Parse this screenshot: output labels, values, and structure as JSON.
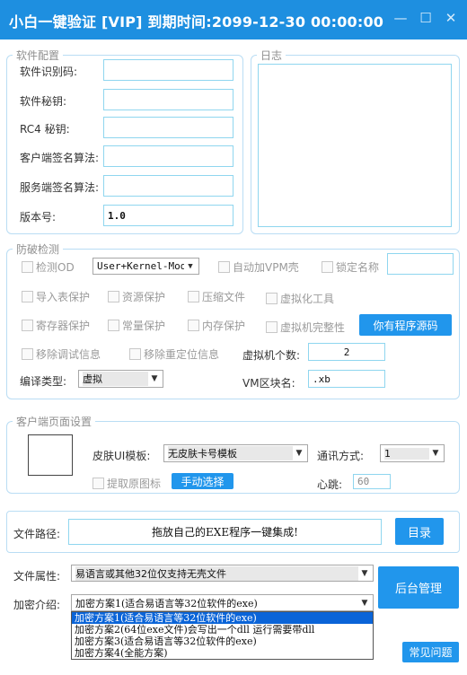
{
  "window": {
    "title": "小白一键验证 [VIP]  到期时间:2099-12-30 00:00:00",
    "minimize": "—",
    "maximize": "☐",
    "close": "✕"
  },
  "config": {
    "legend": "软件配置",
    "fields": [
      {
        "label": "软件识别码:",
        "value": ""
      },
      {
        "label": "软件秘钥:",
        "value": ""
      },
      {
        "label": "RC4 秘钥:",
        "value": ""
      },
      {
        "label": "客户端签名算法:",
        "value": ""
      },
      {
        "label": "服务端签名算法:",
        "value": ""
      },
      {
        "label": "版本号:",
        "value": "1.0"
      }
    ]
  },
  "log": {
    "legend": "日志",
    "content": ""
  },
  "protect": {
    "legend": "防破检测",
    "od_label": "检测OD",
    "mode_value": "User+Kernel-Mode",
    "vpm_label": "自动加VPM壳",
    "lockname_label": "锁定名称",
    "lockname_value": "",
    "import_label": "导入表保护",
    "resource_label": "资源保护",
    "compress_label": "压缩文件",
    "virtualize_label": "虚拟化工具",
    "register_label": "寄存器保护",
    "const_label": "常量保护",
    "memory_label": "内存保护",
    "vmcheck_label": "虚拟机完整性",
    "source_button": "你有程序源码",
    "debug_label": "移除调试信息",
    "reloc_label": "移除重定位信息",
    "vmcount_label": "虚拟机个数:",
    "vmcount_value": "2",
    "compile_label": "编译类型:",
    "compile_value": "虚拟",
    "vmblock_label": "VM区块名:",
    "vmblock_value": ".xb"
  },
  "client": {
    "legend": "客户端页面设置",
    "skin_label": "皮肤UI模板:",
    "skin_value": "无皮肤卡号模板",
    "comm_label": "通讯方式:",
    "comm_value": "1",
    "icon_label": "提取原图标",
    "manual_button": "手动选择",
    "heartbeat_label": "心跳:",
    "heartbeat_value": "60"
  },
  "file": {
    "path_label": "文件路径:",
    "path_value": "拖放自己的EXE程序一键集成!",
    "dir_button": "目录"
  },
  "attr": {
    "label": "文件属性:",
    "value": "易语言或其他32位仅支持无壳文件"
  },
  "backend_button": "后台管理",
  "encrypt": {
    "label": "加密介绍:",
    "value": "加密方案1(适合易语言等32位软件的exe)",
    "options": [
      "加密方案1(适合易语言等32位软件的exe)",
      "加密方案2(64位exe文件)会写出一个dll 运行需要带dll",
      "加密方案3(适合易语言等32位软件的exe)",
      "加密方案4(全能方案)"
    ]
  },
  "faq_button": "常见问题",
  "colors": {
    "accent": "#2196ec",
    "titlebar": "#1e8fe0",
    "group_border": "#b9ddf4",
    "field_border": "#8fd6ef",
    "selection": "#0a64d8"
  }
}
